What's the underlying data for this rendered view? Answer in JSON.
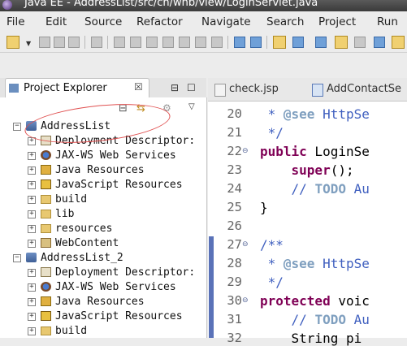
{
  "window": {
    "title": "Java EE - AddressList/src/cn/wnb/view/LoginServlet.java"
  },
  "menu": [
    "File",
    "Edit",
    "Source",
    "Refactor",
    "Navigate",
    "Search",
    "Project",
    "Run"
  ],
  "explorer": {
    "tab_label": "Project Explorer",
    "tab_close": "☒",
    "minimize": "⊟",
    "maximize": "☐",
    "tree": [
      {
        "label": "AddressList",
        "icon": "project-icon",
        "indent": 0,
        "expanded": true
      },
      {
        "label": "Deployment Descriptor:",
        "icon": "deployment-descriptor-icon",
        "indent": 1
      },
      {
        "label": "JAX-WS Web Services",
        "icon": "web-services-icon",
        "indent": 1
      },
      {
        "label": "Java Resources",
        "icon": "java-resources-icon",
        "indent": 1
      },
      {
        "label": "JavaScript Resources",
        "icon": "javascript-resources-icon",
        "indent": 1
      },
      {
        "label": "build",
        "icon": "folder-icon",
        "indent": 1
      },
      {
        "label": "lib",
        "icon": "folder-icon",
        "indent": 1
      },
      {
        "label": "resources",
        "icon": "folder-icon",
        "indent": 1
      },
      {
        "label": "WebContent",
        "icon": "web-content-icon",
        "indent": 1
      },
      {
        "label": "AddressList_2",
        "icon": "project-icon",
        "indent": 0,
        "expanded": true
      },
      {
        "label": "Deployment Descriptor:",
        "icon": "deployment-descriptor-icon",
        "indent": 1
      },
      {
        "label": "JAX-WS Web Services",
        "icon": "web-services-icon",
        "indent": 1
      },
      {
        "label": "Java Resources",
        "icon": "java-resources-icon",
        "indent": 1
      },
      {
        "label": "JavaScript Resources",
        "icon": "javascript-resources-icon",
        "indent": 1
      },
      {
        "label": "build",
        "icon": "folder-icon",
        "indent": 1
      }
    ]
  },
  "editor": {
    "tabs": [
      "check.jsp",
      "AddContactSe"
    ],
    "lines": [
      {
        "n": "20",
        "text": " * @see HttpSe",
        "style": "cm"
      },
      {
        "n": "21",
        "text": " */",
        "style": "cm"
      },
      {
        "n": "22",
        "text": "public LoginSe",
        "style": "decl",
        "fold": "⊖"
      },
      {
        "n": "23",
        "text": "    super();",
        "style": "super"
      },
      {
        "n": "24",
        "text": "    // TODO Au",
        "style": "todo"
      },
      {
        "n": "25",
        "text": "}",
        "style": "plain"
      },
      {
        "n": "26",
        "text": "",
        "style": "plain"
      },
      {
        "n": "27",
        "text": "/**",
        "style": "cm",
        "fold": "⊖"
      },
      {
        "n": "28",
        "text": " * @see HttpSe",
        "style": "cm"
      },
      {
        "n": "29",
        "text": " */",
        "style": "cm"
      },
      {
        "n": "30",
        "text": "protected voic",
        "style": "decl2",
        "fold": "⊖"
      },
      {
        "n": "31",
        "text": "    // TODO Au",
        "style": "todo"
      },
      {
        "n": "32",
        "text": "    String pi",
        "style": "plain"
      }
    ]
  },
  "colors": {
    "annotation": "#e05050",
    "comment": "#3f5fbf",
    "keyword": "#7f0055"
  }
}
